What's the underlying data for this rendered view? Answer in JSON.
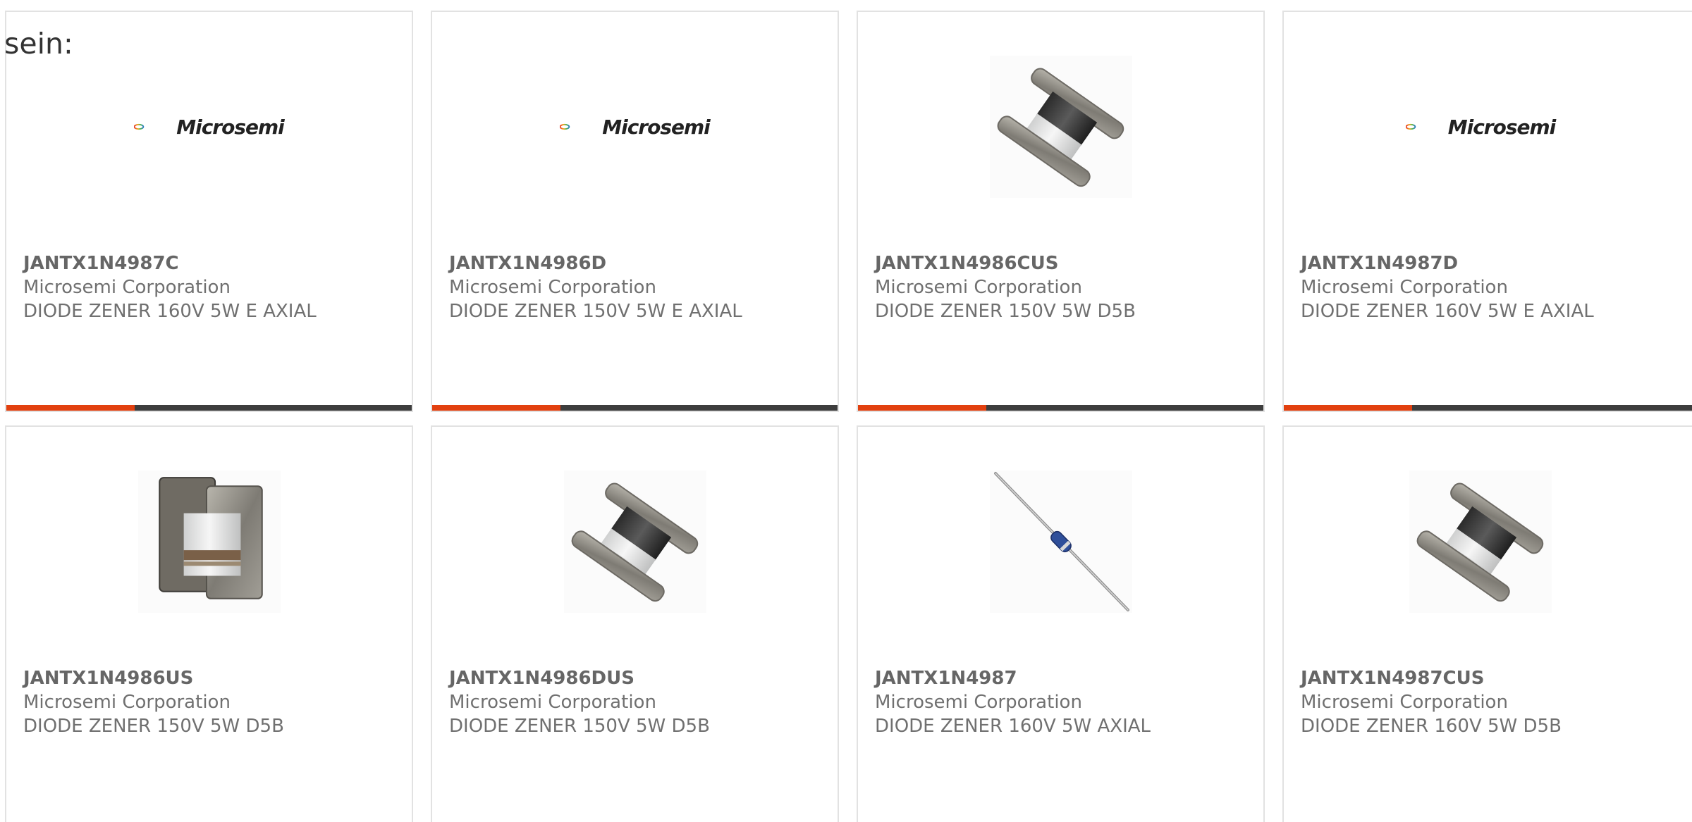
{
  "heading": "sein:",
  "colors": {
    "accent": "#e2400f",
    "bar": "#3d3d3d",
    "border": "#e2e2e2",
    "text": "#707070"
  },
  "products": [
    {
      "part": "JANTX1N4987C",
      "manufacturer": "Microsemi Corporation",
      "description": "DIODE ZENER 160V 5W E AXIAL",
      "image": "microsemi-logo",
      "logo_text": "Microsemi"
    },
    {
      "part": "JANTX1N4986D",
      "manufacturer": "Microsemi Corporation",
      "description": "DIODE ZENER 150V 5W E AXIAL",
      "image": "microsemi-logo",
      "logo_text": "Microsemi"
    },
    {
      "part": "JANTX1N4986CUS",
      "manufacturer": "Microsemi Corporation",
      "description": "DIODE ZENER 150V 5W D5B",
      "image": "d5b-diode-photo"
    },
    {
      "part": "JANTX1N4987D",
      "manufacturer": "Microsemi Corporation",
      "description": "DIODE ZENER 160V 5W E AXIAL",
      "image": "microsemi-logo",
      "logo_text": "Microsemi"
    },
    {
      "part": "JANTX1N4986US",
      "manufacturer": "Microsemi Corporation",
      "description": "DIODE ZENER 150V 5W D5B",
      "image": "square-melf-diode-photo"
    },
    {
      "part": "JANTX1N4986DUS",
      "manufacturer": "Microsemi Corporation",
      "description": "DIODE ZENER 150V 5W D5B",
      "image": "d5b-diode-photo"
    },
    {
      "part": "JANTX1N4987",
      "manufacturer": "Microsemi Corporation",
      "description": "DIODE ZENER 160V 5W AXIAL",
      "image": "axial-diode-photo"
    },
    {
      "part": "JANTX1N4987CUS",
      "manufacturer": "Microsemi Corporation",
      "description": "DIODE ZENER 160V 5W D5B",
      "image": "d5b-diode-photo"
    }
  ]
}
